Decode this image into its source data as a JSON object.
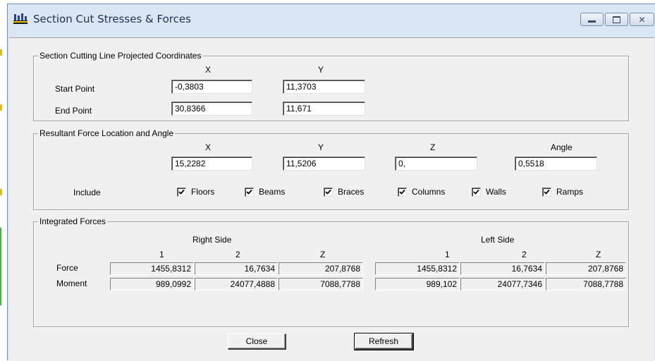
{
  "window": {
    "title": "Section Cut Stresses & Forces"
  },
  "section_cut": {
    "legend": "Section Cutting Line Projected Coordinates",
    "col_x": "X",
    "col_y": "Y",
    "start": {
      "label": "Start Point",
      "x": "-0,3803",
      "y": "11,3703"
    },
    "end": {
      "label": "End Point",
      "x": "30,8366",
      "y": "11,671"
    }
  },
  "resultant": {
    "legend": "Resultant Force Location and Angle",
    "col_x": "X",
    "col_y": "Y",
    "col_z": "Z",
    "col_angle": "Angle",
    "x": "15,2282",
    "y": "11,5206",
    "z": "0,",
    "angle": "0,5518",
    "include_label": "Include",
    "include": [
      {
        "label": "Floors",
        "checked": true
      },
      {
        "label": "Beams",
        "checked": true
      },
      {
        "label": "Braces",
        "checked": true
      },
      {
        "label": "Columns",
        "checked": true
      },
      {
        "label": "Walls",
        "checked": true
      },
      {
        "label": "Ramps",
        "checked": true
      }
    ]
  },
  "integrated": {
    "legend": "Integrated Forces",
    "right_side": "Right Side",
    "left_side": "Left Side",
    "cols": [
      "1",
      "2",
      "Z"
    ],
    "force_label": "Force",
    "moment_label": "Moment",
    "right_force": [
      "1455,8312",
      "16,7634",
      "207,8768"
    ],
    "right_moment": [
      "989,0992",
      "24077,4888",
      "7088,7788"
    ],
    "left_force": [
      "1455,8312",
      "16,7634",
      "207,8768"
    ],
    "left_moment": [
      "989,102",
      "24077,7346",
      "7088,7788"
    ]
  },
  "buttons": {
    "close": "Close",
    "refresh": "Refresh"
  },
  "colors": {
    "titlebar": "#dbe6f4",
    "dialog": "#f0f0f0"
  }
}
